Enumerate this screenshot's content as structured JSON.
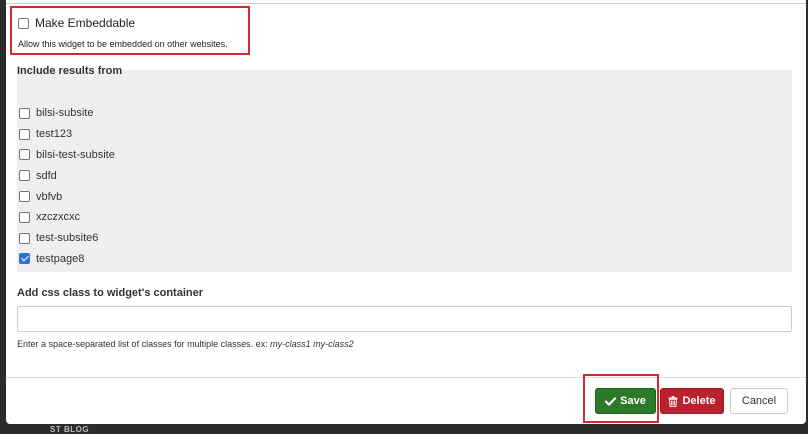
{
  "embed": {
    "label": "Make Embeddable",
    "help": "Allow this widget to be embedded on other websites.",
    "checked": false
  },
  "results": {
    "title": "Include results from",
    "items": [
      {
        "label": "bilsi-subsite",
        "checked": false
      },
      {
        "label": "test123",
        "checked": false
      },
      {
        "label": "bilsi-test-subsite",
        "checked": false
      },
      {
        "label": "sdfd",
        "checked": false
      },
      {
        "label": "vbfvb",
        "checked": false
      },
      {
        "label": "xzczxcxc",
        "checked": false
      },
      {
        "label": "test-subsite6",
        "checked": false
      },
      {
        "label": "testpage8",
        "checked": true
      }
    ]
  },
  "css_class": {
    "label": "Add css class to widget's container",
    "value": "",
    "help_prefix": "Enter a space-separated list of classes for multiple classes. ex:",
    "help_example": "my-class1 my-class2"
  },
  "buttons": {
    "save": "Save",
    "delete": "Delete",
    "cancel": "Cancel"
  },
  "background_text": "ST  BLOG",
  "colors": {
    "save": "#2a7a2a",
    "delete": "#b8212d",
    "highlight": "#d9262f",
    "checkbox_checked": "#2e70d8"
  }
}
